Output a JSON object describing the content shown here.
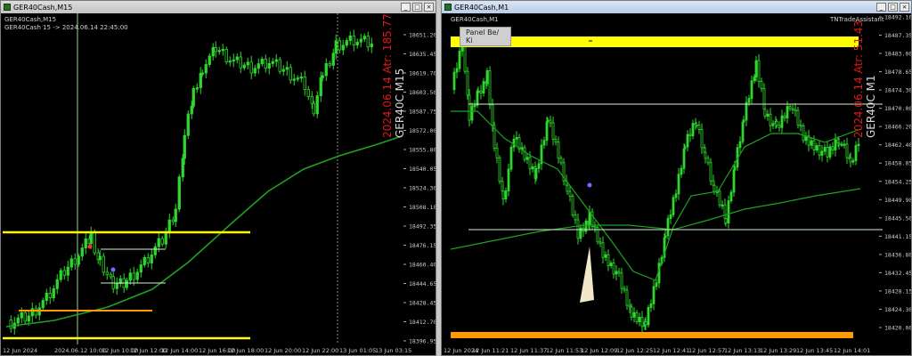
{
  "left": {
    "window_title": "GER40Cash,M15",
    "chart_header": "GER40Cash,M15",
    "info_line": "GER40Cash 15 -> 2024.06.14 22:45:00",
    "overlay_date": "2024.06.14 Atr: 185.77",
    "overlay_symbol": "GER40C M15",
    "price_labels": [
      "18651.20",
      "18635.45",
      "18619.70",
      "18603.50",
      "18587.75",
      "18572.00",
      "18555.80",
      "18540.05",
      "18524.30",
      "18508.10",
      "18492.35",
      "18476.15",
      "18460.40",
      "18444.65",
      "18428.45",
      "18412.70",
      "18396.95"
    ],
    "time_labels": [
      "12 Jun 2024",
      "2024.06.12 10:00",
      "12 Jun 10:00",
      "12 Jun 12:00",
      "12 Jun 14:00",
      "12 Jun 16:00",
      "12 Jun 18:00",
      "12 Jun 20:00",
      "12 Jun 22:00",
      "13 Jun 01:05",
      "13 Jun 03:15"
    ],
    "colors": {
      "candle": "#2fd62f",
      "ma": "#1fa21f",
      "yellow": "#ffff00",
      "orange": "#ff9900",
      "label_red": "#e01818",
      "label_white": "#d8d8d8"
    }
  },
  "right": {
    "window_title": "GER40Cash,M1",
    "chart_header": "GER40Cash,M1",
    "panel_button": "Panel Be/ Ki",
    "assistant_label": "TNTradeAssistant",
    "overlay_date": "2024.06.14 Atr: 51.43",
    "overlay_symbol": "GER40C M1",
    "price_labels": [
      "18492.10",
      "18487.35",
      "18483.00",
      "18478.65",
      "18474.30",
      "18470.00",
      "18466.20",
      "18462.40",
      "18458.05",
      "18454.25",
      "18449.90",
      "18445.50",
      "18441.15",
      "18436.80",
      "18432.45",
      "18428.15",
      "18424.30",
      "18420.00"
    ],
    "time_labels": [
      "12 Jun 2024",
      "12 Jun 11:21",
      "12 Jun 11:37",
      "12 Jun 11:53",
      "12 Jun 12:09",
      "12 Jun 12:25",
      "12 Jun 12:41",
      "12 Jun 12:57",
      "12 Jun 13:13",
      "12 Jun 13:29",
      "12 Jun 13:45",
      "12 Jun 14:01"
    ],
    "colors": {
      "candle": "#2fd62f",
      "ma": "#1fa21f",
      "yellow": "#ffff00",
      "orange": "#ff9900",
      "line": "#d4f0d4"
    }
  }
}
